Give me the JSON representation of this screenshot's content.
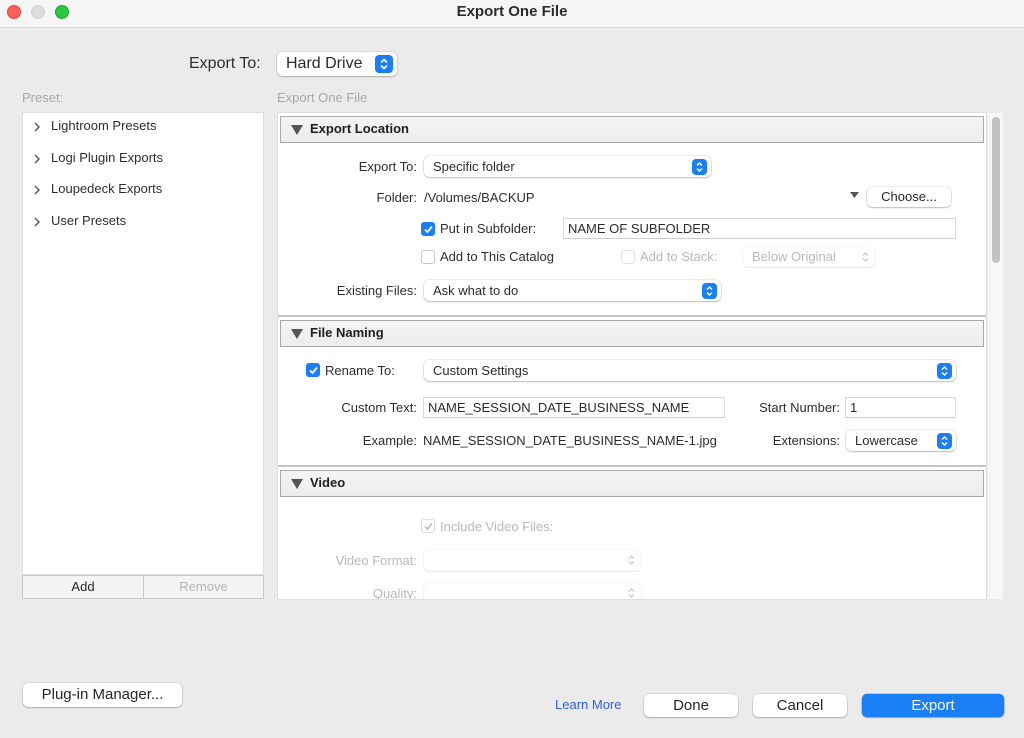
{
  "window": {
    "title": "Export One File"
  },
  "top": {
    "export_to_label": "Export To:",
    "export_to_value": "Hard Drive"
  },
  "preset": {
    "header": "Preset:",
    "items": [
      {
        "label": "Lightroom Presets"
      },
      {
        "label": "Logi Plugin Exports"
      },
      {
        "label": "Loupedeck Exports"
      },
      {
        "label": "User Presets"
      }
    ],
    "add_label": "Add",
    "remove_label": "Remove"
  },
  "settings": {
    "header": "Export One File",
    "export_location": {
      "title": "Export Location",
      "export_to_label": "Export To:",
      "export_to_value": "Specific folder",
      "folder_label": "Folder:",
      "folder_value": "/Volumes/BACKUP",
      "choose_label": "Choose...",
      "subfolder_label": "Put in Subfolder:",
      "subfolder_checked": true,
      "subfolder_value": "NAME OF SUBFOLDER",
      "add_catalog_label": "Add to This Catalog",
      "add_catalog_checked": false,
      "add_stack_label": "Add to Stack:",
      "add_stack_checked": false,
      "add_stack_value": "Below Original",
      "existing_files_label": "Existing Files:",
      "existing_files_value": "Ask what to do"
    },
    "file_naming": {
      "title": "File Naming",
      "rename_label": "Rename To:",
      "rename_checked": true,
      "rename_value": "Custom Settings",
      "custom_text_label": "Custom Text:",
      "custom_text_value": "NAME_SESSION_DATE_BUSINESS_NAME",
      "start_number_label": "Start Number:",
      "start_number_value": "1",
      "example_label": "Example:",
      "example_value": "NAME_SESSION_DATE_BUSINESS_NAME-1.jpg",
      "extensions_label": "Extensions:",
      "extensions_value": "Lowercase"
    },
    "video": {
      "title": "Video",
      "include_label": "Include Video Files:",
      "include_checked": true,
      "format_label": "Video Format:",
      "format_value": "",
      "quality_label": "Quality:",
      "quality_value": ""
    }
  },
  "footer": {
    "plugin_manager_label": "Plug-in Manager...",
    "learn_more_label": "Learn More",
    "done_label": "Done",
    "cancel_label": "Cancel",
    "export_label": "Export"
  },
  "colors": {
    "accent": "#1a7ff6",
    "link": "#2f5fe0",
    "window_bg": "#ebebeb"
  }
}
